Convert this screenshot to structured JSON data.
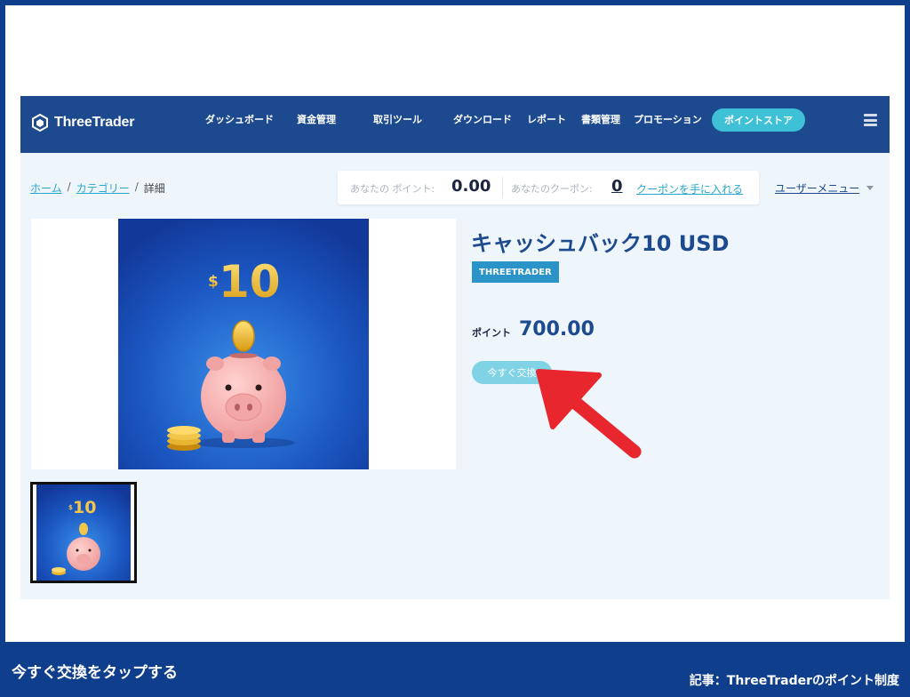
{
  "app": {
    "logo_text": "ThreeTrader",
    "nav": [
      "ダッシュボード",
      "資金管理",
      "取引ツール",
      "ダウンロード",
      "レポート",
      "書類管理",
      "プロモーション"
    ],
    "nav_pill": "ポイントストア"
  },
  "breadcrumb": {
    "home": "ホーム",
    "category": "カテゴリー",
    "current": "詳細",
    "separator": "/"
  },
  "points_card": {
    "points_label": "あなたの ポイント:",
    "points_value": "0.00",
    "coupons_label": "あなたのクーポン:",
    "coupons_value": "0",
    "coupon_link": "クーポンを手に入れる"
  },
  "user_menu": "ユーザーメニュー",
  "product": {
    "title": "キャッシュバック10 USD",
    "brand": "THREETRADER",
    "price_label": "ポイント",
    "price_value": "700.00",
    "exchange_button": "今すぐ交換",
    "image_text": "10",
    "image_currency": "$"
  },
  "caption": {
    "main": "今すぐ交換をタップする",
    "sub": "記事：ThreeTraderのポイント制度"
  },
  "colors": {
    "frame": "#0f3f8c",
    "header": "#1d4a8f",
    "accent": "#3ec0d6",
    "button": "#7fd3e4",
    "badge": "#2a94c9",
    "arrow": "#e8262d",
    "content_bg": "#eef6fc"
  }
}
